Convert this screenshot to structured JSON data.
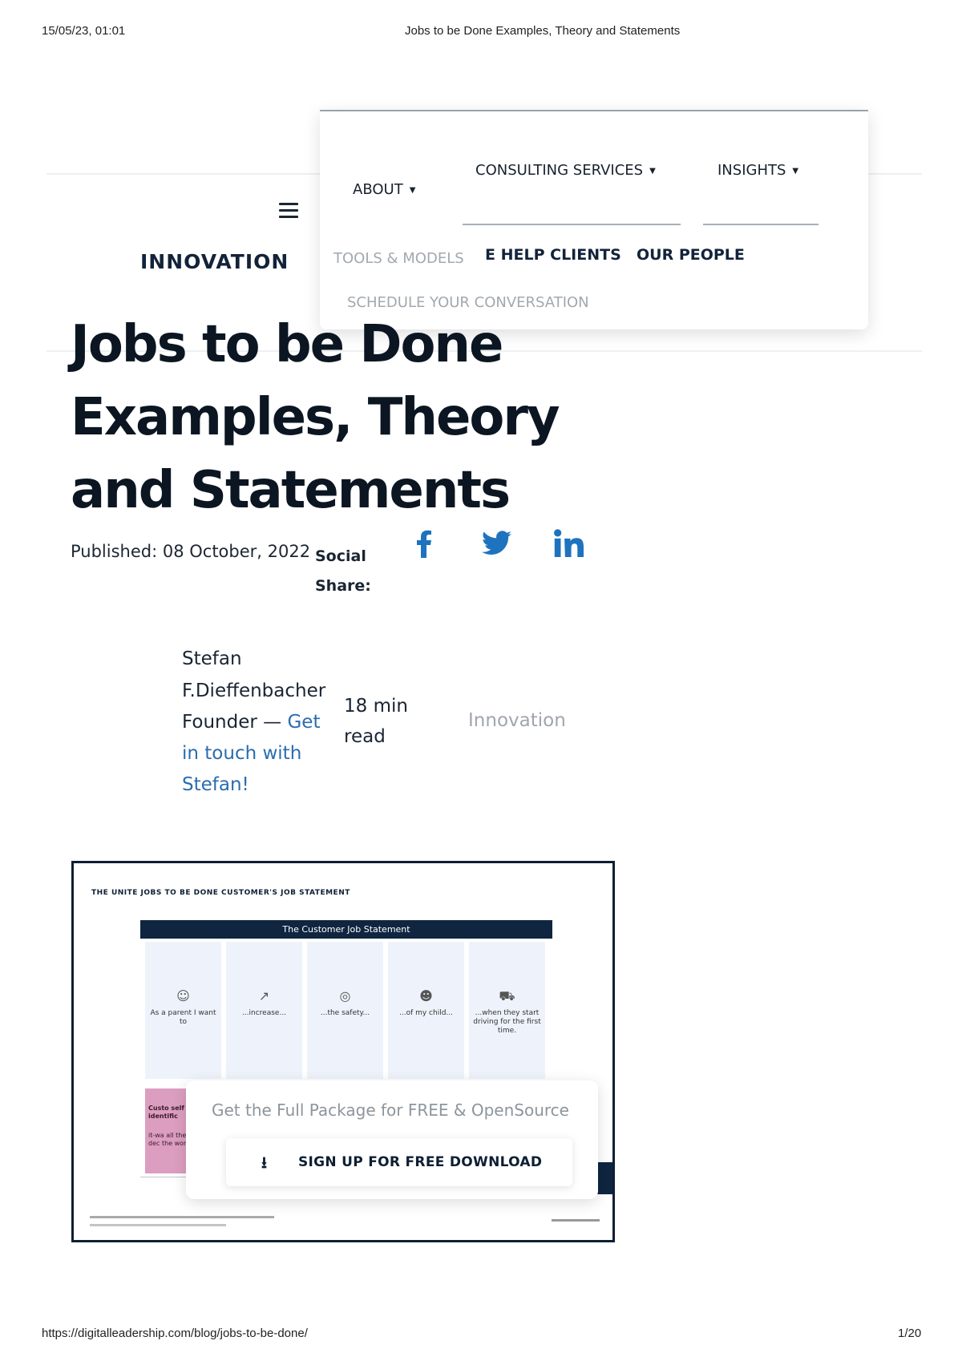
{
  "print_header": {
    "datetime": "15/05/23, 01:01",
    "doc_title": "Jobs to be Done Examples, Theory and Statements"
  },
  "print_footer": {
    "url": "https://digitalleadership.com/blog/jobs-to-be-done/",
    "page": "1/20"
  },
  "nav": {
    "about": "ABOUT",
    "consulting": "CONSULTING SERVICES",
    "insights": "INSIGHTS",
    "tools": "TOOLS & MODELS",
    "help_clients": "E HELP CLIENTS",
    "our_people": "OUR PEOPLE",
    "schedule": "SCHEDULE YOUR CONVERSATION",
    "caret_icon": "caret-down-icon",
    "menu_icon": "hamburger-menu-icon"
  },
  "category_tab": "INNOVATION",
  "article": {
    "title": "Jobs to be Done Examples, Theory and Statements",
    "published": "Published: 08 October, 2022",
    "social_share_label": "Social Share:",
    "social_icons": [
      "facebook-icon",
      "twitter-icon",
      "linkedin-icon"
    ],
    "social_color": "#1e73be",
    "author_name": "Stefan F.Dieffenbacher",
    "author_role": "Founder — ",
    "author_link": "Get in touch with Stefan!",
    "read_time": "18 min read",
    "category": "Innovation"
  },
  "figure": {
    "heading": "THE UNITE JOBS TO BE DONE CUSTOMER'S JOB STATEMENT",
    "bar_label": "The Customer Job Statement",
    "columns": [
      {
        "icon": "parent-icon",
        "text": "As a parent I want to"
      },
      {
        "icon": "increase-icon",
        "text": "...increase..."
      },
      {
        "icon": "safety-icon",
        "text": "...the safety..."
      },
      {
        "icon": "child-icon",
        "text": "...of my child..."
      },
      {
        "icon": "car-icon",
        "text": "...when they start driving for the first time."
      }
    ],
    "pink_label": "Custo self identific",
    "pink_sub": "it-wa all the dec the work",
    "accent_color": "#dc9ec0",
    "dark_color": "#0f2540"
  },
  "promo": {
    "text": "Get the Full Package for FREE & OpenSource",
    "button_label": "SIGN UP FOR FREE DOWNLOAD",
    "button_icon": "download-icon"
  }
}
